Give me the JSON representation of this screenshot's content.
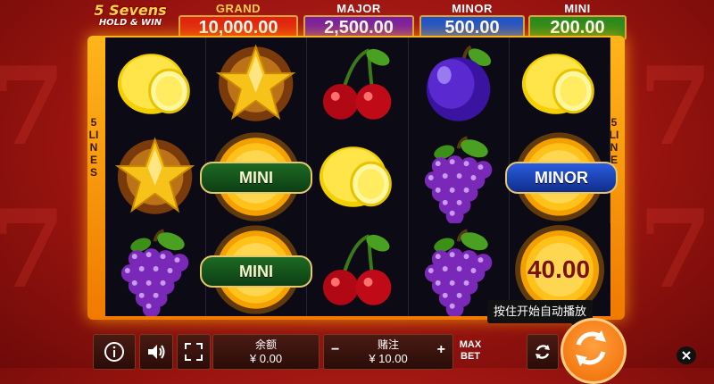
{
  "logo": {
    "line1": "5 Sevens",
    "line2": "HOLD & WIN"
  },
  "jackpots": {
    "grand": {
      "title": "GRAND",
      "value": "10,000.00"
    },
    "major": {
      "title": "MAJOR",
      "value": "2,500.00"
    },
    "minor": {
      "title": "MINOR",
      "value": "500.00"
    },
    "mini": {
      "title": "MINI",
      "value": "200.00"
    }
  },
  "lines_label": {
    "left": "5 LINES",
    "right": "5 LINES"
  },
  "reels": [
    [
      "lemon",
      "star",
      "grapes"
    ],
    [
      "star",
      "coin-mini",
      "coin-mini"
    ],
    [
      "cherry",
      "lemon",
      "cherry"
    ],
    [
      "plum",
      "grapes",
      "grapes"
    ],
    [
      "lemon",
      "coin-minor",
      "coin-value"
    ]
  ],
  "coins": {
    "mini_1": "MINI",
    "mini_2": "MINI",
    "minor": "MINOR",
    "value": "40.00"
  },
  "tooltip": "按住开始自动播放",
  "bottom_bar": {
    "balance_label": "余额",
    "balance_value": "¥ 0.00",
    "bet_label": "赌注",
    "bet_value": "¥ 10.00",
    "minus": "−",
    "plus": "+",
    "max_bet": "MAX BET"
  },
  "colors": {
    "frame": "#f59a10",
    "grand": "#e02410",
    "major": "#7a1fa0",
    "minor": "#1f53c9",
    "mini": "#2a8a1c"
  }
}
